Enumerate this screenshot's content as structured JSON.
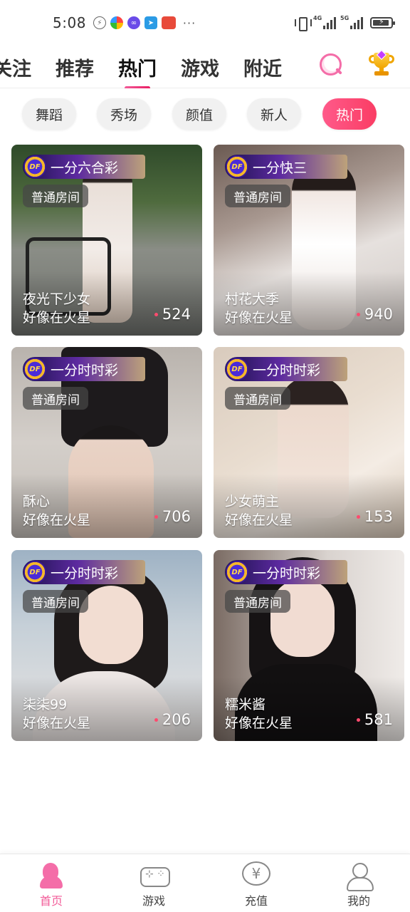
{
  "status_bar": {
    "time": "5:08",
    "more": "···",
    "network_1": "4G",
    "network_2": "5G"
  },
  "top_nav": {
    "tabs": [
      {
        "label": "关注"
      },
      {
        "label": "推荐"
      },
      {
        "label": "热门"
      },
      {
        "label": "游戏"
      },
      {
        "label": "附近"
      }
    ],
    "active_tab": "热门",
    "accent_color": "#f25b98"
  },
  "categories": [
    {
      "label": "舞蹈"
    },
    {
      "label": "秀场"
    },
    {
      "label": "颜值"
    },
    {
      "label": "新人"
    },
    {
      "label": "热门"
    }
  ],
  "active_category": "热门",
  "rooms": [
    {
      "game": "一分六合彩",
      "room_type": "普通房间",
      "name": "夜光下少女",
      "location": "好像在火星",
      "viewers": "524"
    },
    {
      "game": "一分快三",
      "room_type": "普通房间",
      "name": "村花大季",
      "location": "好像在火星",
      "viewers": "940"
    },
    {
      "game": "一分时时彩",
      "room_type": "普通房间",
      "name": "酥心",
      "location": "好像在火星",
      "viewers": "706"
    },
    {
      "game": "一分时时彩",
      "room_type": "普通房间",
      "name": "少女萌主",
      "location": "好像在火星",
      "viewers": "153"
    },
    {
      "game": "一分时时彩",
      "room_type": "普通房间",
      "name": "柒柒99",
      "location": "好像在火星",
      "viewers": "206"
    },
    {
      "game": "一分时时彩",
      "room_type": "普通房间",
      "name": "糯米酱",
      "location": "好像在火星",
      "viewers": "581"
    }
  ],
  "bottom_nav": {
    "items": [
      {
        "label": "首页",
        "icon": "home-avatar-icon"
      },
      {
        "label": "游戏",
        "icon": "gamepad-icon"
      },
      {
        "label": "充值",
        "icon": "yuan-coin-icon"
      },
      {
        "label": "我的",
        "icon": "user-icon"
      }
    ],
    "active": "首页",
    "recharge_symbol": "¥"
  }
}
